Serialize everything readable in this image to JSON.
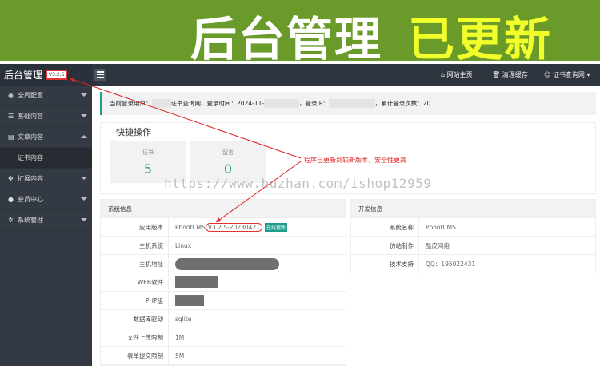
{
  "banner": {
    "title_white": "后台管理",
    "title_yellow": "已更新"
  },
  "sidebar": {
    "brand": "后台管理",
    "version": "V3.2.5",
    "items": [
      {
        "label": "全局配置",
        "icon": "globe-icon",
        "glyph": "◉"
      },
      {
        "label": "基础内容",
        "icon": "sliders-icon",
        "glyph": "☰"
      },
      {
        "label": "文章内容",
        "icon": "file-icon",
        "glyph": "▤"
      },
      {
        "label": "证书内容",
        "icon": "sub-item",
        "glyph": ""
      },
      {
        "label": "扩展内容",
        "icon": "expand-icon",
        "glyph": "✥"
      },
      {
        "label": "会员中心",
        "icon": "user-icon",
        "glyph": "●"
      },
      {
        "label": "系统管理",
        "icon": "gear-icon",
        "glyph": "✲"
      }
    ]
  },
  "topbar": {
    "home": "网站主页",
    "home_glyph": "⌂",
    "clear_cache": "清理缓存",
    "clear_glyph": "🗑",
    "account": "证书查询网",
    "account_glyph": "☺"
  },
  "login": {
    "user_prefix": "当前登录用户：",
    "site": "证书查询网，登录时间：",
    "time": "2024-11-",
    "ip": "，登录IP：",
    "count": "，累计登录次数：",
    "count_value": "20"
  },
  "quick": {
    "title": "快捷操作",
    "boxes": [
      {
        "label": "证书",
        "value": "5"
      },
      {
        "label": "留言",
        "value": "0"
      }
    ]
  },
  "annotation": "程序已更新到较新版本，安全性更高",
  "watermark": "https://www.huzhan.com/ishop12959",
  "sysinfo": {
    "title": "系统信息",
    "rows": [
      {
        "key": "应用版本",
        "value_prefix": "PbootCMS ",
        "value_ver": "V3.2.5-20230421",
        "badge": "在线更新"
      },
      {
        "key": "主机系统",
        "value": "Linux"
      },
      {
        "key": "主机地址",
        "value": ""
      },
      {
        "key": "WEB软件",
        "value": ""
      },
      {
        "key": "PHP版",
        "value": ""
      },
      {
        "key": "数据库驱动",
        "value": "sqlite"
      },
      {
        "key": "文件上传限制",
        "value": "1M"
      },
      {
        "key": "表单提交限制",
        "value": "5M"
      }
    ]
  },
  "devinfo": {
    "title": "开发信息",
    "rows": [
      {
        "key": "系统名称",
        "value": "PbootCMS"
      },
      {
        "key": "仿站制作",
        "value": "酷皮网络"
      },
      {
        "key": "技术支持",
        "value": "QQ：195022431"
      }
    ]
  },
  "colors": {
    "accent": "#1e9e8a",
    "banner": "#6a9a2a",
    "sidebar": "#333a43",
    "annotation": "#dd2222"
  }
}
